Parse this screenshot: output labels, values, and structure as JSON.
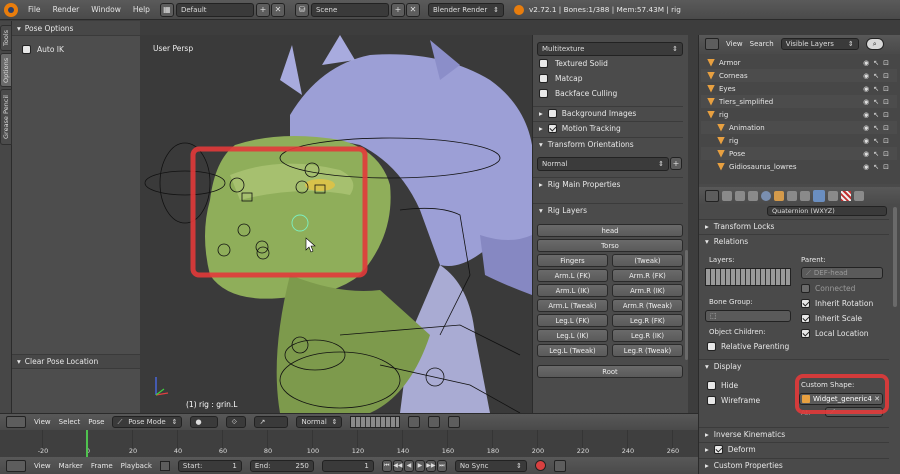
{
  "topbar": {
    "menus": [
      "File",
      "Render",
      "Window",
      "Help"
    ],
    "layout_name": "Default",
    "scene_name": "Scene",
    "render_engine": "Blender Render",
    "stats": "v2.72.1 | Bones:1/388 | Mem:57.43M | rig"
  },
  "left_tabs": [
    "Tools",
    "Options",
    "Grease Pencil"
  ],
  "tool_panel": {
    "pose_options_title": "Pose Options",
    "auto_ik_label": "Auto IK",
    "clear_pose_title": "Clear Pose Location"
  },
  "viewport": {
    "view_label": "User Persp",
    "status": "(1) rig : grin.L"
  },
  "viewport_header": {
    "items": [
      "View",
      "Select",
      "Pose"
    ],
    "mode": "Pose Mode",
    "pivot": "Normal"
  },
  "props_panel": {
    "shading_mode": "Multitexture",
    "checks": [
      {
        "label": "Textured Solid",
        "checked": false
      },
      {
        "label": "Matcap",
        "checked": false
      },
      {
        "label": "Backface Culling",
        "checked": false
      }
    ],
    "background_images": "Background Images",
    "motion_tracking": "Motion Tracking",
    "transform_orientations": "Transform Orientations",
    "orientation_value": "Normal",
    "rig_main_properties": "Rig Main Properties",
    "rig_layers_title": "Rig Layers",
    "rig_layers": {
      "head": "head",
      "torso": "Torso",
      "pairs": [
        [
          "Fingers",
          "(Tweak)"
        ],
        [
          "Arm.L (FK)",
          "Arm.R (FK)"
        ],
        [
          "Arm.L (IK)",
          "Arm.R (IK)"
        ],
        [
          "Arm.L (Tweak)",
          "Arm.R (Tweak)"
        ],
        [
          "Leg.L (FK)",
          "Leg.R (FK)"
        ],
        [
          "Leg.L (IK)",
          "Leg.R (IK)"
        ],
        [
          "Leg.L (Tweak)",
          "Leg.R (Tweak)"
        ]
      ],
      "root": "Root"
    }
  },
  "outliner": {
    "header_items": [
      "View",
      "Search"
    ],
    "filter_value": "Visible Layers",
    "items": [
      {
        "label": "Armor",
        "indent": 0
      },
      {
        "label": "Corneas",
        "indent": 0
      },
      {
        "label": "Eyes",
        "indent": 0
      },
      {
        "label": "Tiers_simplified",
        "indent": 0
      },
      {
        "label": "rig",
        "indent": 0
      },
      {
        "label": "Animation",
        "indent": 1
      },
      {
        "label": "rig",
        "indent": 1
      },
      {
        "label": "Pose",
        "indent": 1
      },
      {
        "label": "Gidiosaurus_lowres",
        "indent": 1
      }
    ]
  },
  "bone_props": {
    "rotation_mode_value": "Quaternion (WXYZ)",
    "transform_locks": "Transform Locks",
    "relations": "Relations",
    "layers_label": "Layers:",
    "parent_label": "Parent:",
    "parent_value": "DEF-head",
    "connected_label": "Connected",
    "bone_group_label": "Bone Group:",
    "inherit_rotation": "Inherit Rotation",
    "inherit_scale": "Inherit Scale",
    "local_location": "Local Location",
    "object_children_label": "Object Children:",
    "relative_parenting": "Relative Parenting",
    "display": "Display",
    "hide_label": "Hide",
    "wireframe_label": "Wireframe",
    "custom_shape_label": "Custom Shape:",
    "custom_shape_value": "Widget_generic4",
    "at_label": "At:",
    "inverse_kinematics": "Inverse Kinematics",
    "deform": "Deform",
    "custom_properties": "Custom Properties"
  },
  "timeline": {
    "header_items": [
      "View",
      "Marker",
      "Frame",
      "Playback"
    ],
    "ticks": [
      "-20",
      "0",
      "20",
      "40",
      "60",
      "80",
      "100",
      "120",
      "140",
      "160",
      "180",
      "200",
      "220",
      "240",
      "260"
    ],
    "start_label": "Start:",
    "start_value": "1",
    "end_label": "End:",
    "end_value": "250",
    "current_frame": "1",
    "sync_mode": "No Sync"
  },
  "colors": {
    "highlight_red": "#e23a3a",
    "header_bg": "#4a4a4a",
    "panel_bg": "#4b4b4b",
    "creature_green": "#8fae5a",
    "armor_lavender": "#9c9fd6",
    "playhead_green": "#4fc24f"
  }
}
